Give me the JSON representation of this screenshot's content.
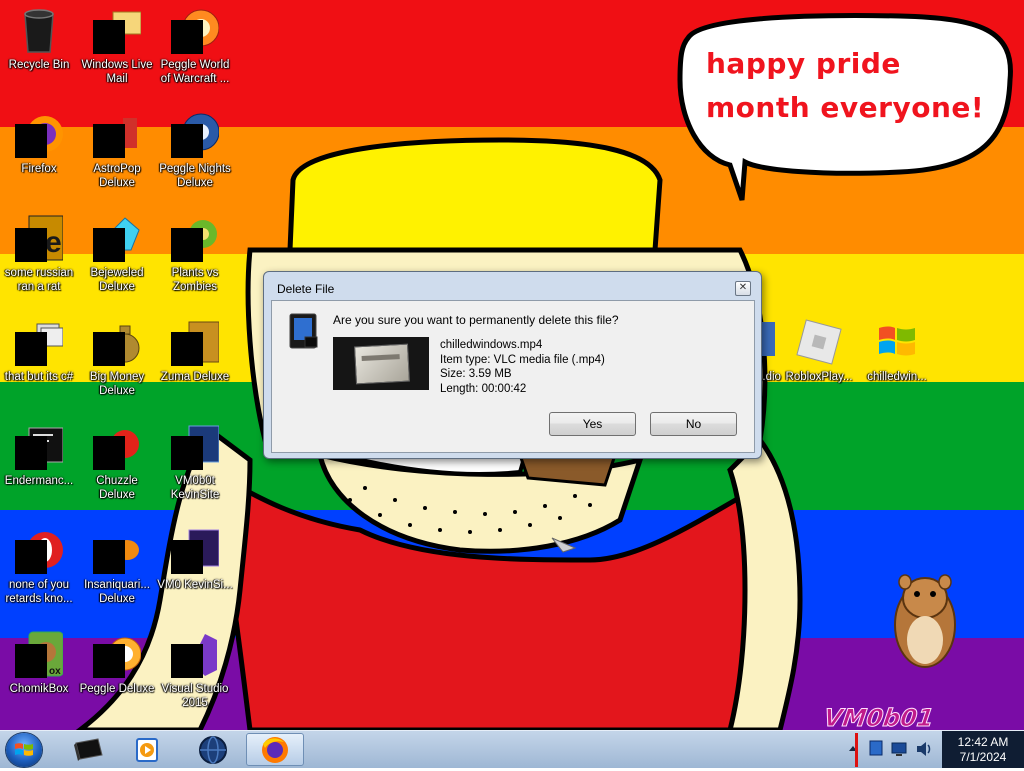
{
  "wallpaper": {
    "speech_text": "happy pride month everyone!",
    "watermark": "VM0b01"
  },
  "desktop_icons": [
    {
      "label": "Recycle Bin"
    },
    {
      "label": "Windows Live Mail"
    },
    {
      "label": "Peggle World of Warcraft ..."
    },
    {
      "label": "Firefox"
    },
    {
      "label": "AstroPop Deluxe"
    },
    {
      "label": "Peggle Nights Deluxe"
    },
    {
      "label": "some russian ran a rat"
    },
    {
      "label": "Bejeweled Deluxe"
    },
    {
      "label": "Plants vs Zombies"
    },
    {
      "label": "that but its c#"
    },
    {
      "label": "Big Money Deluxe"
    },
    {
      "label": "Zuma Deluxe"
    },
    {
      "label": "Endermanc..."
    },
    {
      "label": "Chuzzle Deluxe"
    },
    {
      "label": "VM0b0t KevinSite"
    },
    {
      "label": "none of you retards kno..."
    },
    {
      "label": "Insaniquari... Deluxe"
    },
    {
      "label": "VM0 KevinSi..."
    },
    {
      "label": "ChomikBox"
    },
    {
      "label": "Peggle Deluxe"
    },
    {
      "label": "Visual Studio 2015"
    },
    {
      "label": "...dio"
    },
    {
      "label": "RobloxPlay..."
    },
    {
      "label": "chilledwin..."
    }
  ],
  "dialog": {
    "title": "Delete File",
    "close_glyph": "✕",
    "question": "Are you sure you want to permanently delete this file?",
    "file_name": "chilledwindows.mp4",
    "item_type": "Item type: VLC media file (.mp4)",
    "size": "Size: 3.59 MB",
    "length": "Length: 00:00:42",
    "yes_label": "Yes",
    "no_label": "No"
  },
  "taskbar": {
    "start_icon": "windows-logo-icon",
    "pinned": [
      "console-icon",
      "media-player-icon",
      "globe-icon",
      "firefox-icon"
    ],
    "active_item": "firefox-icon",
    "tray_icons": [
      "show-hidden-icons-icon",
      "network-icon",
      "monitor-icon",
      "speaker-icon"
    ],
    "clock": {
      "time": "12:42 AM",
      "date": "7/1/2024"
    }
  },
  "colors": {
    "pride_red": "#f00f14",
    "pride_orange": "#ff8c00",
    "pride_yellow": "#ffe400",
    "pride_green": "#00a329",
    "pride_blue": "#0040ff",
    "pride_purple": "#7a0ca6",
    "speech_text": "#f0141e"
  }
}
